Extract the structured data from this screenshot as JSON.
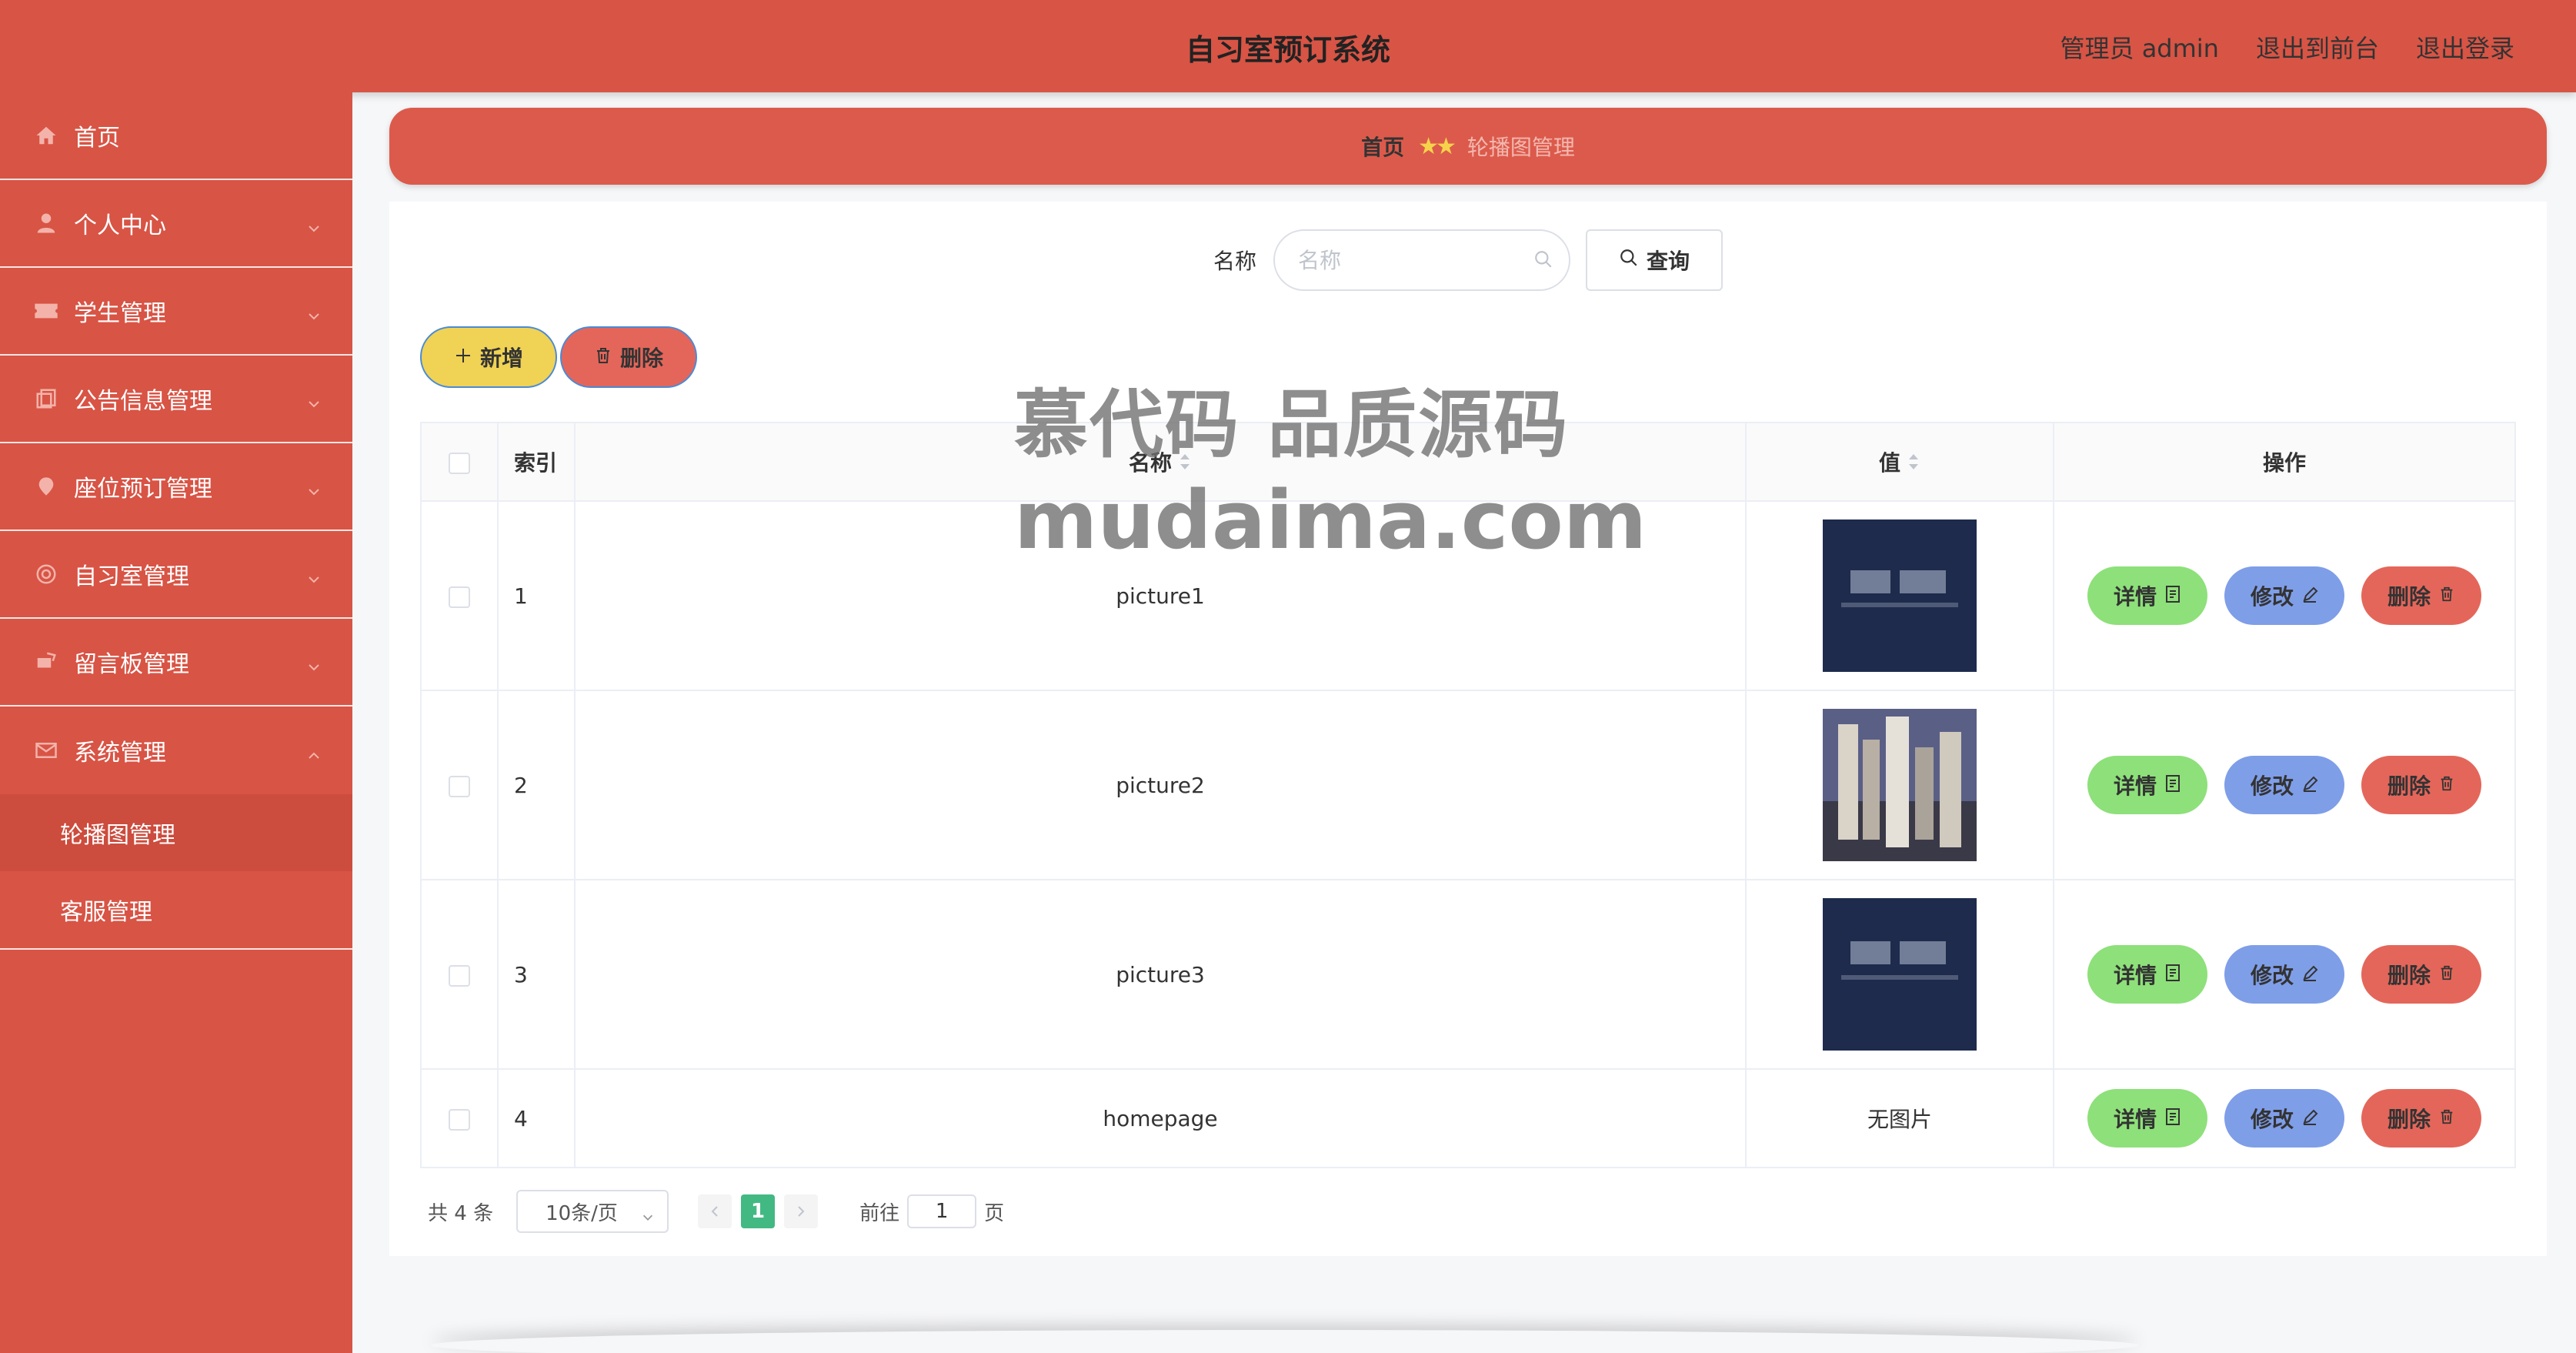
{
  "header": {
    "title": "自习室预订系统",
    "admin_label": "管理员 admin",
    "to_front_label": "退出到前台",
    "logout_label": "退出登录"
  },
  "sidebar": {
    "items": [
      {
        "label": "首页",
        "icon": "home-icon"
      },
      {
        "label": "个人中心",
        "icon": "user-icon"
      },
      {
        "label": "学生管理",
        "icon": "ticket-icon"
      },
      {
        "label": "公告信息管理",
        "icon": "copy-icon"
      },
      {
        "label": "座位预订管理",
        "icon": "location-icon"
      },
      {
        "label": "自习室管理",
        "icon": "globe-icon"
      },
      {
        "label": "留言板管理",
        "icon": "chat-icon"
      },
      {
        "label": "系统管理",
        "icon": "mail-icon"
      }
    ],
    "sub_items": [
      "轮播图管理",
      "客服管理"
    ]
  },
  "breadcrumb": {
    "home": "首页",
    "separator": "★★",
    "current": "轮播图管理"
  },
  "search": {
    "label": "名称",
    "placeholder": "名称",
    "button": "查询"
  },
  "actions": {
    "add": "新增",
    "delete": "删除"
  },
  "table": {
    "columns": [
      "索引",
      "名称",
      "值",
      "操作"
    ],
    "rows": [
      {
        "index": "1",
        "name": "picture1",
        "value": "image-dark-banner"
      },
      {
        "index": "2",
        "name": "picture2",
        "value": "image-books"
      },
      {
        "index": "3",
        "name": "picture3",
        "value": "image-dark-banner"
      },
      {
        "index": "4",
        "name": "homepage",
        "value": "无图片"
      }
    ],
    "ops": {
      "detail": "详情",
      "edit": "修改",
      "remove": "删除"
    }
  },
  "pagination": {
    "total": "共 4 条",
    "page_size": "10条/页",
    "current_page": "1",
    "goto_label": "前往",
    "goto_value": "1",
    "page_suffix": "页"
  },
  "watermark": {
    "line1": "慕代码 品质源码",
    "line2": "mudaima.com"
  },
  "colors": {
    "brand": "#d85445",
    "add_button": "#f0d254",
    "detail_button": "#8ee07a",
    "edit_button": "#7f9ee8",
    "delete_button": "#e4665a",
    "page_active": "#42b983"
  }
}
